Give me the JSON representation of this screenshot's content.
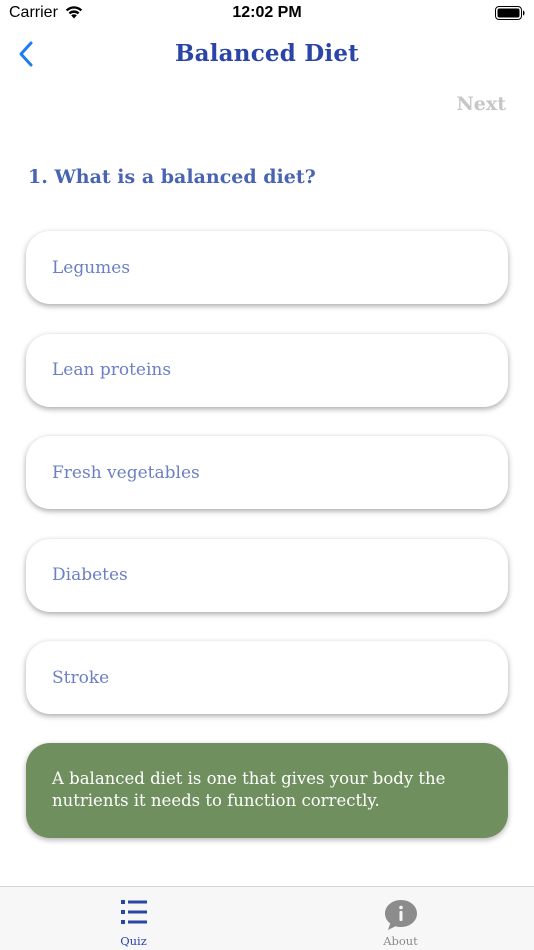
{
  "status_bar": {
    "carrier": "Carrier",
    "time": "12:02 PM"
  },
  "nav": {
    "title": "Balanced Diet",
    "next_label": "Next"
  },
  "quiz": {
    "question": "1. What is a balanced diet?",
    "options": [
      {
        "label": "Legumes"
      },
      {
        "label": "Lean proteins"
      },
      {
        "label": "Fresh vegetables"
      },
      {
        "label": "Diabetes"
      },
      {
        "label": "Stroke"
      }
    ],
    "answer": "A balanced diet is one that gives your body the nutrients it needs to function correctly."
  },
  "tab_bar": {
    "tabs": [
      {
        "label": "Quiz",
        "icon": "list-icon",
        "selected": true
      },
      {
        "label": "About",
        "icon": "info-bubble-icon",
        "selected": false
      }
    ]
  },
  "colors": {
    "title": "#2a45a6",
    "question": "#4a64b3",
    "option_text": "#6b7fc2",
    "answer_bg": "#708f5f",
    "next_disabled": "#c6c6c6",
    "back_blue": "#1e7cf2"
  }
}
